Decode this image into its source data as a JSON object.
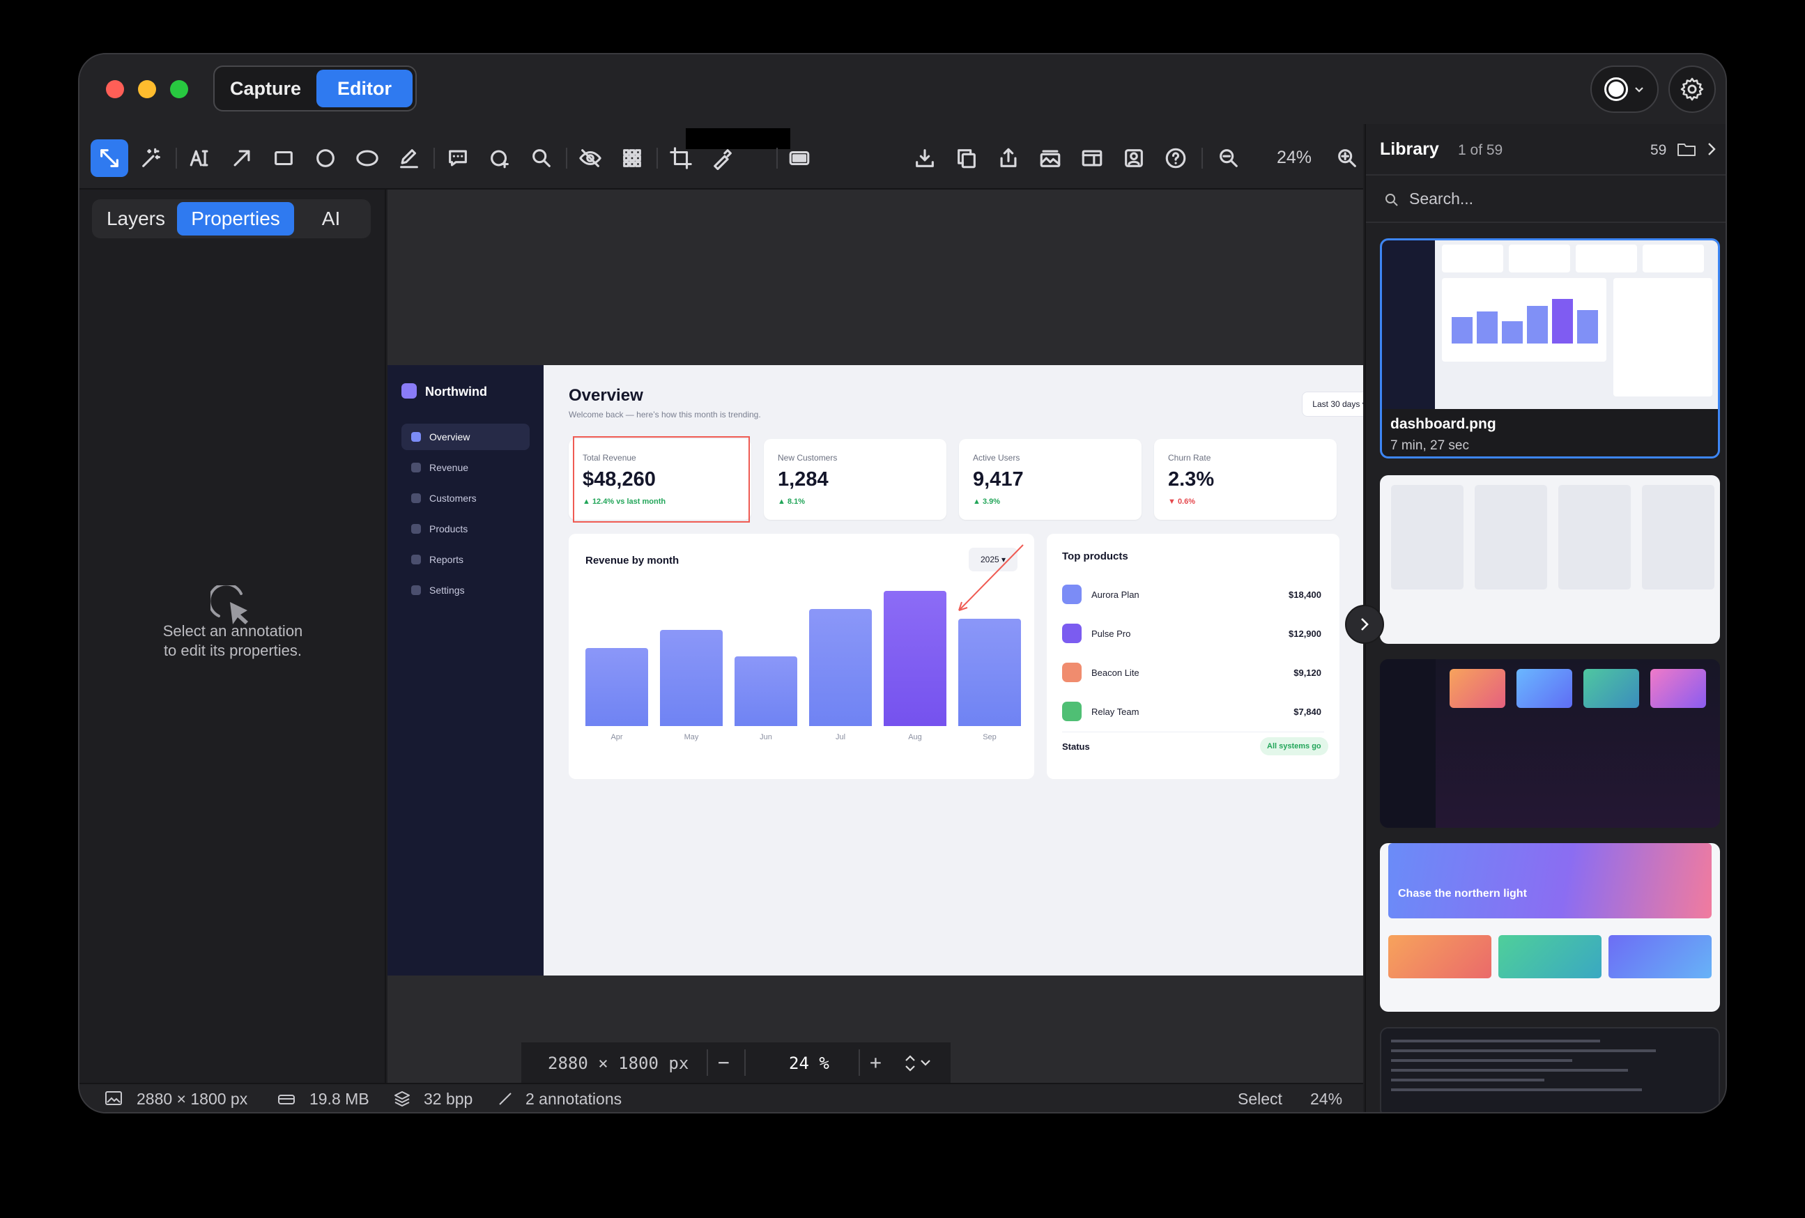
{
  "window": {
    "mode_tabs": [
      "Capture",
      "Editor"
    ],
    "active_mode": "Editor"
  },
  "toolbar": {
    "zoom": "24%",
    "tools": [
      "select-tool",
      "magic-tool",
      "text-tool",
      "arrow-tool",
      "rectangle-tool",
      "circle-tool",
      "ellipse-tool",
      "pen-tool",
      "speech-bubble-tool",
      "shape-add-tool",
      "magnifier-tool",
      "blur-tool",
      "pixelate-tool",
      "crop-tool",
      "color-picker-tool",
      "redact-tool"
    ]
  },
  "left_panel": {
    "tabs": [
      "Layers",
      "Properties",
      "AI"
    ],
    "active_tab": "Properties",
    "hint_line1": "Select an annotation",
    "hint_line2": "to edit its properties."
  },
  "canvas": {
    "dimensions": "2880 × 1800 px",
    "zoom": "24 %"
  },
  "dashboard": {
    "brand": "Northwind",
    "nav": [
      "Overview",
      "Revenue",
      "Customers",
      "Products",
      "Reports",
      "Settings"
    ],
    "title": "Overview",
    "subtitle": "Welcome back — here’s how this month is trending.",
    "range": "Last 30 days ▾",
    "kpis": [
      {
        "label": "Total Revenue",
        "value": "$48,260",
        "change": "▲ 12.4% vs last month",
        "color": "#22a559"
      },
      {
        "label": "New Customers",
        "value": "1,284",
        "change": "▲ 8.1%",
        "color": "#22a559"
      },
      {
        "label": "Active Users",
        "value": "9,417",
        "change": "▲ 3.9%",
        "color": "#22a559"
      },
      {
        "label": "Churn Rate",
        "value": "2.3%",
        "change": "▼ 0.6%",
        "color": "#e5484d"
      }
    ],
    "chart_title": "Revenue by month",
    "year": "2025 ▾",
    "top_products_title": "Top products",
    "products": [
      {
        "name": "Aurora Plan",
        "value": "$18,400",
        "color": "#7b8cf6"
      },
      {
        "name": "Pulse Pro",
        "value": "$12,900",
        "color": "#7b5cf0"
      },
      {
        "name": "Beacon Lite",
        "value": "$9,120",
        "color": "#f08c6e"
      },
      {
        "name": "Relay Team",
        "value": "$7,840",
        "color": "#4fbf74"
      }
    ],
    "status_label": "Status",
    "status_value": "All systems go"
  },
  "chart_data": {
    "type": "bar",
    "categories": [
      "Apr",
      "May",
      "Jun",
      "Jul",
      "Aug",
      "Sep"
    ],
    "values": [
      56,
      69,
      50,
      84,
      97,
      77
    ],
    "ylim": [
      0,
      100
    ],
    "highlight": "Aug"
  },
  "status_bar": {
    "dimensions": "2880 × 1800 px",
    "size": "19.8 MB",
    "depth": "32 bpp",
    "annotations": "2 annotations",
    "tool": "Select",
    "zoom": "24%"
  },
  "library": {
    "title": "Library",
    "position": "1 of 59",
    "count": "59",
    "search_placeholder": "Search...",
    "items": [
      {
        "name": "dashboard.png",
        "meta": "7 min, 27 sec"
      }
    ],
    "thumb2_title": "Chase the northern light"
  }
}
